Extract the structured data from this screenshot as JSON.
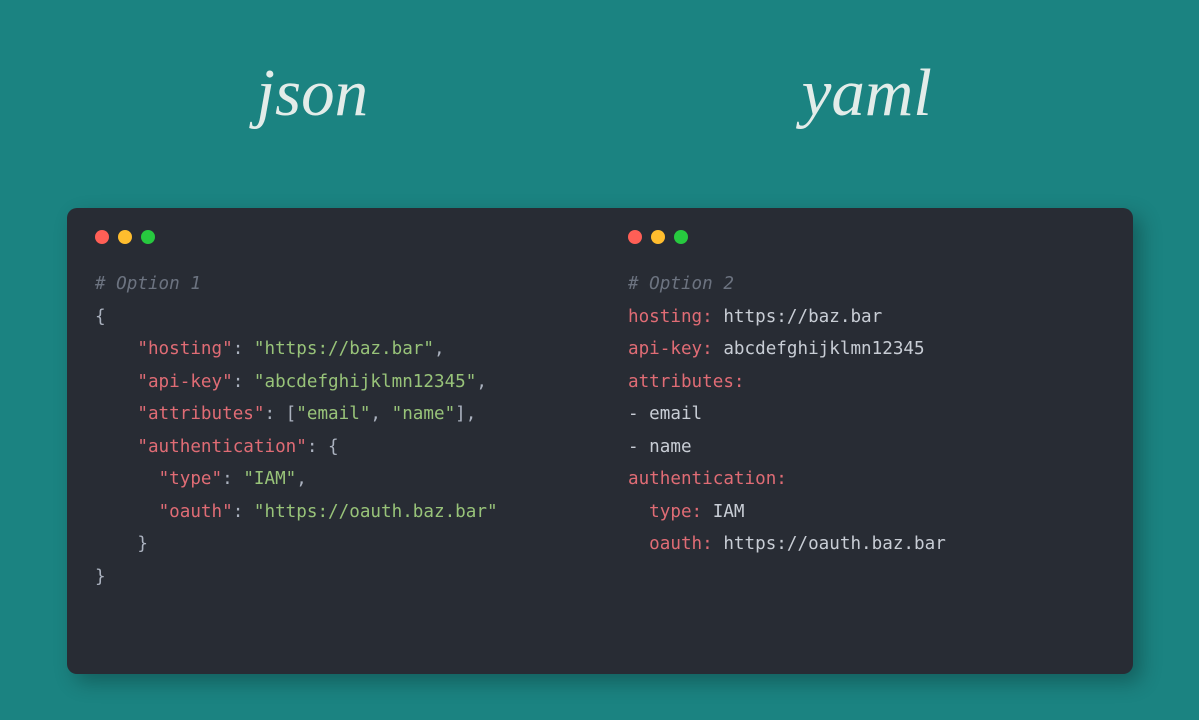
{
  "headings": {
    "left": "json",
    "right": "yaml"
  },
  "json_pane": {
    "comment": "# Option 1",
    "open": "{",
    "hosting_key": "\"hosting\"",
    "hosting_val": "\"https://baz.bar\"",
    "apikey_key": "\"api-key\"",
    "apikey_val": "\"abcdefghijklmn12345\"",
    "attr_key": "\"attributes\"",
    "attr_v1": "\"email\"",
    "attr_v2": "\"name\"",
    "auth_key": "\"authentication\"",
    "type_key": "\"type\"",
    "type_val": "\"IAM\"",
    "oauth_key": "\"oauth\"",
    "oauth_val": "\"https://oauth.baz.bar\"",
    "close_inner": "    }",
    "close": "}"
  },
  "yaml_pane": {
    "comment": "# Option 2",
    "hosting_key": "hosting:",
    "hosting_val": " https://baz.bar",
    "apikey_key": "api-key:",
    "apikey_val": " abcdefghijklmn12345",
    "attr_key": "attributes:",
    "attr_v1": "- email",
    "attr_v2": "- name",
    "auth_key": "authentication:",
    "type_key": "  type:",
    "type_val": " IAM",
    "oauth_key": "  oauth:",
    "oauth_val": " https://oauth.baz.bar"
  }
}
